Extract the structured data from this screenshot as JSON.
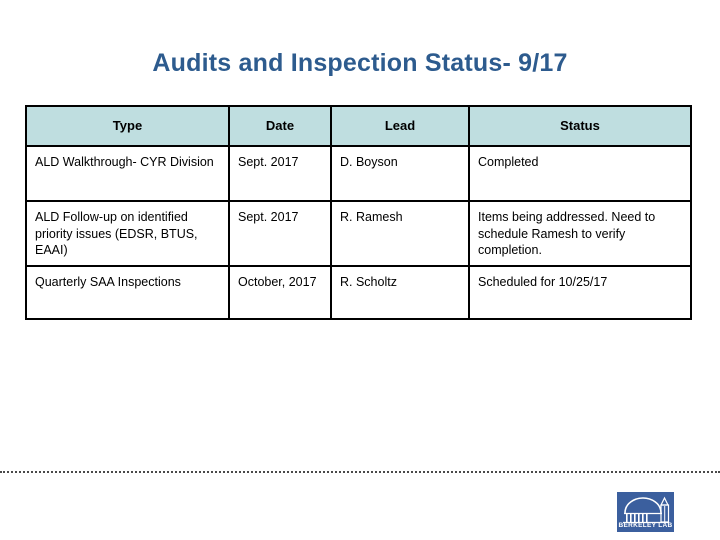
{
  "slide": {
    "title": "Audits and Inspection Status- 9/17",
    "title_color": "#2d5b8e",
    "background_color": "#ffffff"
  },
  "table": {
    "header_background": "#bfdee0",
    "border_color": "#000000",
    "columns": [
      {
        "key": "type",
        "label": "Type"
      },
      {
        "key": "date",
        "label": "Date"
      },
      {
        "key": "lead",
        "label": "Lead"
      },
      {
        "key": "status",
        "label": "Status"
      }
    ],
    "rows": [
      {
        "type": "ALD Walkthrough- CYR Division",
        "date": "Sept. 2017",
        "lead": "D. Boyson",
        "status": "Completed",
        "status_bold": true
      },
      {
        "type": "ALD Follow-up on identified priority issues (EDSR, BTUS, EAAI)",
        "date": "Sept. 2017",
        "lead": "R. Ramesh",
        "status": "Items being addressed. Need to schedule Ramesh to verify completion.",
        "status_bold": false
      },
      {
        "type": "Quarterly SAA Inspections",
        "date": "October, 2017",
        "lead": "R. Scholtz",
        "status": "Scheduled for 10/25/17",
        "status_bold": false
      }
    ]
  },
  "footer": {
    "logo": {
      "wordmark": "BERKELEY LAB",
      "background_color": "#3b5f9e",
      "icon": "berkeley-lab-dome-icon"
    },
    "divider": "dotted-rule"
  }
}
